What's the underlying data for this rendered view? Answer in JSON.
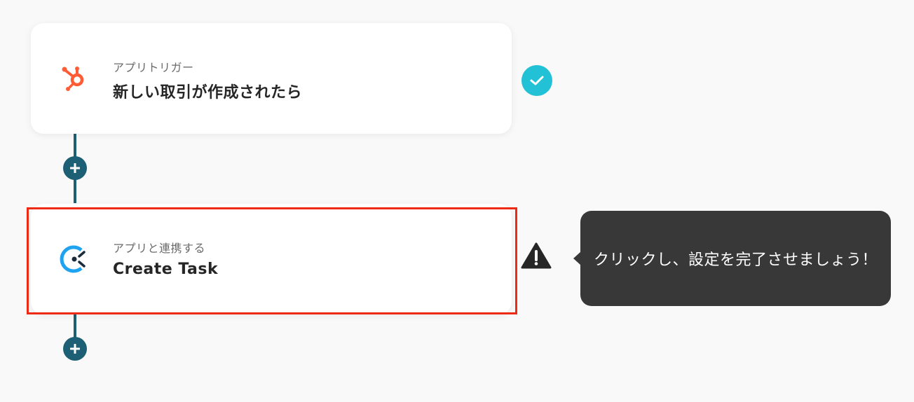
{
  "flow": {
    "steps": [
      {
        "subtitle": "アプリトリガー",
        "title": "新しい取引が作成されたら",
        "icon": "hubspot-icon",
        "status": "complete"
      },
      {
        "subtitle": "アプリと連携する",
        "title": "Create Task",
        "icon": "clickup-icon",
        "status": "warning"
      }
    ]
  },
  "tooltip": {
    "text": "クリックし、設定を完了させましょう！"
  },
  "colors": {
    "accent": "#1d5f74",
    "check": "#22c1d6",
    "highlight": "#ee2a15",
    "hubspot": "#ff5c35",
    "tooltip_bg": "#383838"
  }
}
